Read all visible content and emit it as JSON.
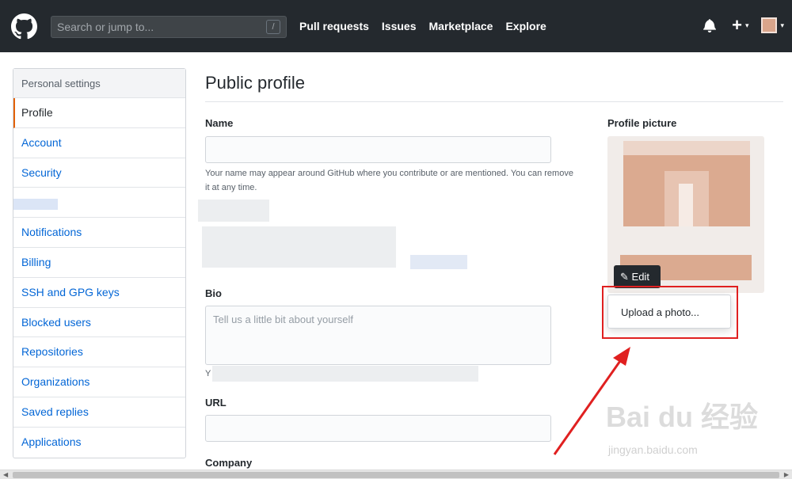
{
  "header": {
    "search_placeholder": "Search or jump to...",
    "search_shortcut": "/",
    "nav": [
      "Pull requests",
      "Issues",
      "Marketplace",
      "Explore"
    ],
    "plus": "+",
    "caret": "▾"
  },
  "sidebar": {
    "heading": "Personal settings",
    "items": [
      {
        "label": "Profile"
      },
      {
        "label": "Account"
      },
      {
        "label": "Security"
      },
      {
        "label": ""
      },
      {
        "label": "Notifications"
      },
      {
        "label": "Billing"
      },
      {
        "label": "SSH and GPG keys"
      },
      {
        "label": "Blocked users"
      },
      {
        "label": "Repositories"
      },
      {
        "label": "Organizations"
      },
      {
        "label": "Saved replies"
      },
      {
        "label": "Applications"
      }
    ]
  },
  "main": {
    "title": "Public profile",
    "name_label": "Name",
    "name_note": "Your name may appear around GitHub where you contribute or are mentioned. You can remove it at any time.",
    "bio_label": "Bio",
    "bio_placeholder": "Tell us a little bit about yourself",
    "bio_note_prefix": "Y",
    "url_label": "URL",
    "company_label": "Company"
  },
  "profile_picture": {
    "label": "Profile picture",
    "edit_label": "Edit",
    "menu_item": "Upload a photo..."
  },
  "watermark": {
    "brand": "Bai du 经验",
    "url": "jingyan.baidu.com"
  },
  "colors": {
    "header_bg": "#24292e",
    "link": "#0366d6",
    "active_marker": "#e36209",
    "annotation_red": "#e02020"
  }
}
